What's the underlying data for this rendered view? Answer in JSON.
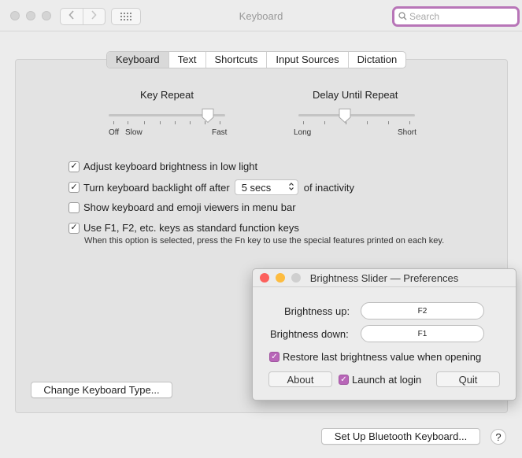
{
  "window": {
    "title": "Keyboard",
    "search_placeholder": "Search",
    "accent_color": "#b875b8"
  },
  "tabs": [
    {
      "label": "Keyboard",
      "selected": true
    },
    {
      "label": "Text",
      "selected": false
    },
    {
      "label": "Shortcuts",
      "selected": false
    },
    {
      "label": "Input Sources",
      "selected": false
    },
    {
      "label": "Dictation",
      "selected": false
    }
  ],
  "key_repeat": {
    "title": "Key Repeat",
    "label_off": "Off",
    "label_slow": "Slow",
    "label_fast": "Fast",
    "level": 0.85
  },
  "delay_until_repeat": {
    "title": "Delay Until Repeat",
    "label_long": "Long",
    "label_short": "Short",
    "level": 0.4
  },
  "options": {
    "adjust_brightness": {
      "label": "Adjust keyboard brightness in low light",
      "checked": true
    },
    "backlight_off": {
      "label": "Turn keyboard backlight off after",
      "value": "5 secs",
      "suffix": "of inactivity",
      "checked": true
    },
    "show_viewers": {
      "label": "Show keyboard and emoji viewers in menu bar",
      "checked": false
    },
    "fn_keys": {
      "label": "Use F1, F2, etc. keys as standard function keys",
      "checked": true
    },
    "fn_note": "When this option is selected, press the Fn key to use the special features printed on each key."
  },
  "buttons": {
    "change_type": "Change Keyboard Type...",
    "bluetooth": "Set Up Bluetooth Keyboard...",
    "help": "?"
  },
  "prefs": {
    "title": "Brightness Slider — Preferences",
    "brightness_up_label": "Brightness up:",
    "brightness_up_key": "F2",
    "brightness_down_label": "Brightness down:",
    "brightness_down_key": "F1",
    "restore": {
      "label": "Restore last brightness value when opening",
      "checked": true
    },
    "about": "About",
    "launch": {
      "label": "Launch at login",
      "checked": true
    },
    "quit": "Quit",
    "colors": {
      "close": "#fc605c",
      "minimize": "#fdbc40",
      "zoom": "#cfcfcf",
      "checkbox": "#b866b8"
    }
  }
}
